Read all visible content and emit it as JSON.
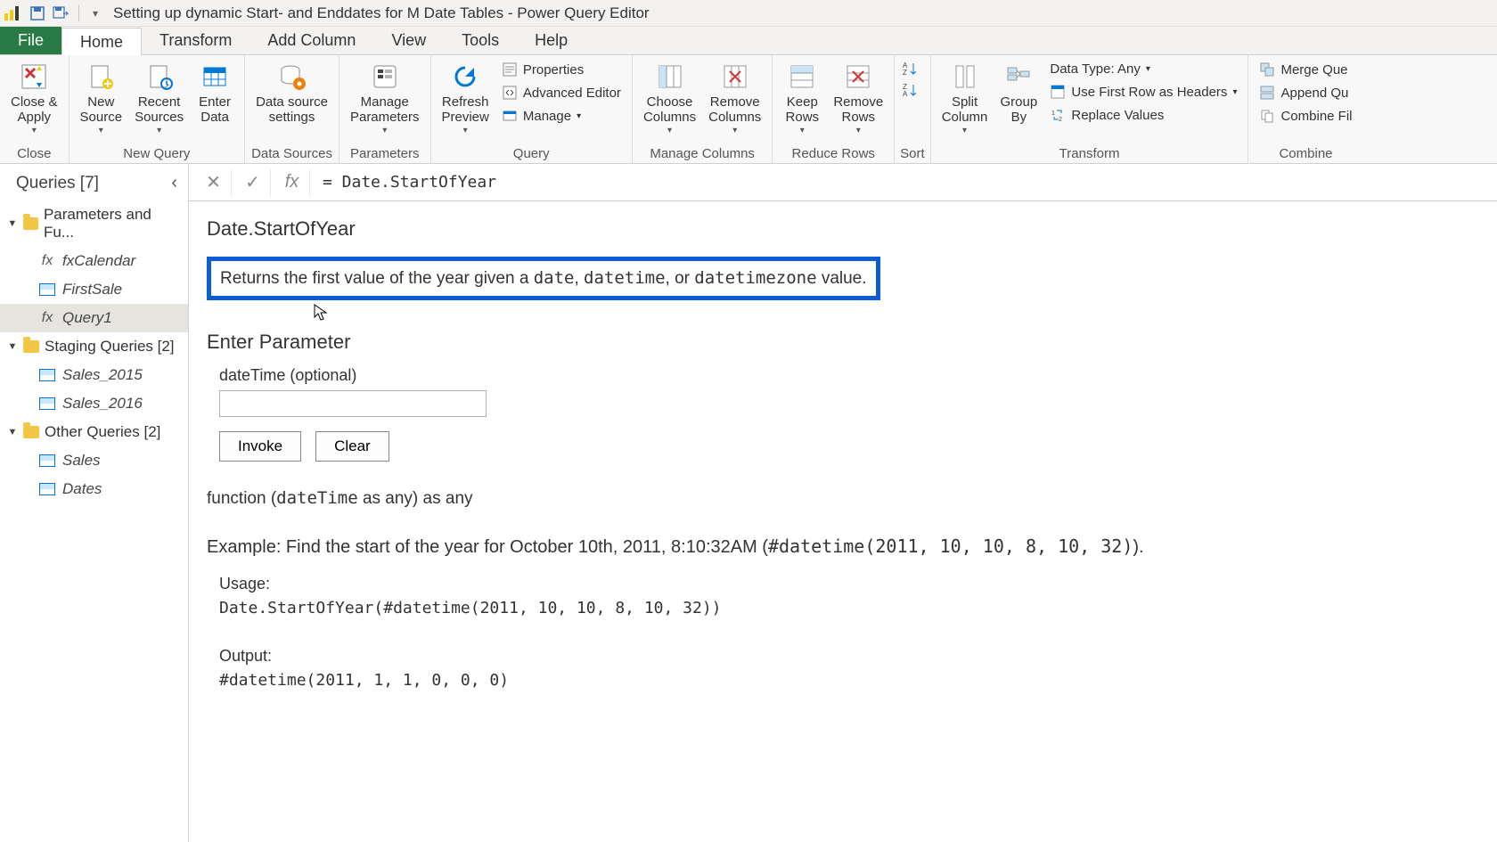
{
  "title": "Setting up dynamic Start- and Enddates for M Date Tables - Power Query Editor",
  "tabs": {
    "file": "File",
    "home": "Home",
    "transform": "Transform",
    "addcolumn": "Add Column",
    "view": "View",
    "tools": "Tools",
    "help": "Help"
  },
  "ribbon": {
    "close_apply": "Close &\nApply",
    "close_group": "Close",
    "new_source": "New\nSource",
    "recent_sources": "Recent\nSources",
    "enter_data": "Enter\nData",
    "new_query_group": "New Query",
    "data_source_settings": "Data source\nsettings",
    "data_sources_group": "Data Sources",
    "manage_parameters": "Manage\nParameters",
    "parameters_group": "Parameters",
    "refresh_preview": "Refresh\nPreview",
    "properties": "Properties",
    "advanced_editor": "Advanced Editor",
    "manage": "Manage",
    "query_group": "Query",
    "choose_columns": "Choose\nColumns",
    "remove_columns": "Remove\nColumns",
    "manage_columns_group": "Manage Columns",
    "keep_rows": "Keep\nRows",
    "remove_rows": "Remove\nRows",
    "reduce_rows_group": "Reduce Rows",
    "sort_group": "Sort",
    "split_column": "Split\nColumn",
    "group_by": "Group\nBy",
    "data_type": "Data Type: Any",
    "use_first_row": "Use First Row as Headers",
    "replace_values": "Replace Values",
    "transform_group": "Transform",
    "merge_queries": "Merge Que",
    "append_queries": "Append Qu",
    "combine_files": "Combine Fil",
    "combine_group": "Combine"
  },
  "queries": {
    "header": "Queries [7]",
    "g1": "Parameters and Fu...",
    "g1_items": {
      "0": "fxCalendar",
      "1": "FirstSale",
      "2": "Query1"
    },
    "g2": "Staging Queries [2]",
    "g2_items": {
      "0": "Sales_2015",
      "1": "Sales_2016"
    },
    "g3": "Other Queries [2]",
    "g3_items": {
      "0": "Sales",
      "1": "Dates"
    }
  },
  "formula": "= Date.StartOfYear",
  "fn": {
    "name": "Date.StartOfYear",
    "desc_pre": "Returns the first value of the year given a ",
    "desc_c1": "date",
    "desc_mid1": ", ",
    "desc_c2": "datetime",
    "desc_mid2": ", or ",
    "desc_c3": "datetimezone",
    "desc_post": " value.",
    "enter_param": "Enter Parameter",
    "param_label": "dateTime (optional)",
    "invoke": "Invoke",
    "clear": "Clear",
    "sig_pre": "function (",
    "sig_param": "dateTime",
    "sig_post": " as any) as any",
    "example_pre": "Example: Find the start of the year for October 10th, 2011, 8:10:32AM (",
    "example_code": "#datetime(2011, 10, 10, 8, 10, 32)",
    "example_post": ").",
    "usage_label": "Usage:",
    "usage_code": "Date.StartOfYear(#datetime(2011, 10, 10, 8, 10, 32))",
    "output_label": "Output:",
    "output_code": "#datetime(2011, 1, 1, 0, 0, 0)"
  }
}
